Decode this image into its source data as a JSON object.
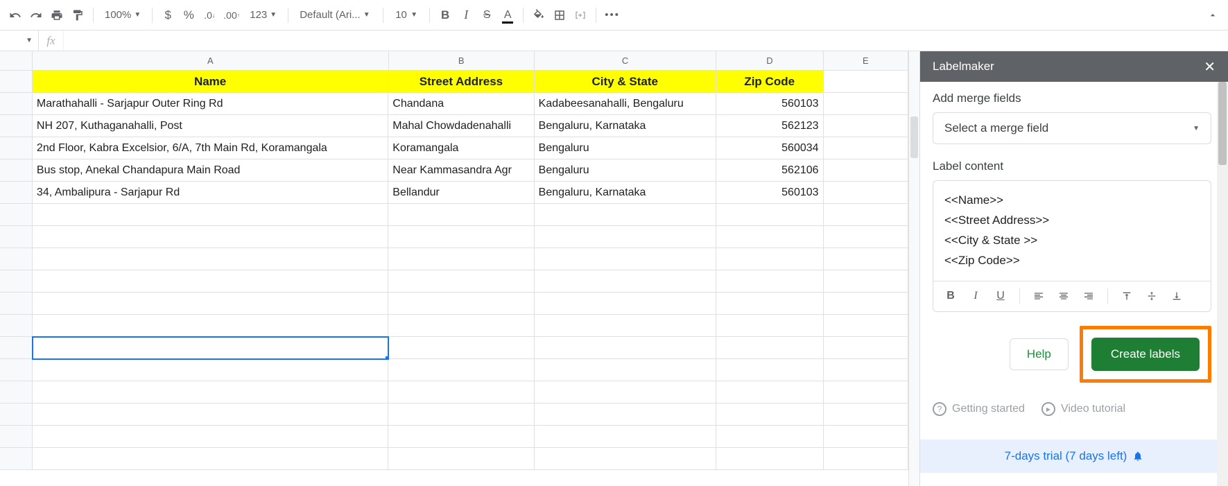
{
  "toolbar": {
    "zoom": "100%",
    "font_name": "Default (Ari...",
    "font_size": "10",
    "number_format": "123"
  },
  "sheet": {
    "columns": [
      "A",
      "B",
      "C",
      "D",
      "E"
    ],
    "headers": {
      "A": "Name",
      "B": "Street Address",
      "C": "City & State",
      "D": "Zip Code"
    },
    "rows": [
      {
        "A": "Marathahalli - Sarjapur Outer Ring Rd",
        "B": "Chandana",
        "C": "Kadabeesanahalli, Bengaluru",
        "D": "560103"
      },
      {
        "A": "NH 207, Kuthaganahalli, Post",
        "B": "Mahal Chowdadenahalli",
        "C": "Bengaluru, Karnataka",
        "D": "562123"
      },
      {
        "A": "2nd Floor, Kabra Excelsior, 6/A, 7th Main Rd, Koramangala ",
        "B": "Koramangala",
        "C": "Bengaluru",
        "D": "560034"
      },
      {
        "A": "Bus stop, Anekal Chandapura Main Road",
        "B": "Near Kammasandra Agr",
        "C": "Bengaluru",
        "D": "562106"
      },
      {
        "A": "34, Ambalipura - Sarjapur Rd",
        "B": "Bellandur",
        "C": "Bengaluru, Karnataka",
        "D": "560103"
      }
    ]
  },
  "sidebar": {
    "title": "Labelmaker",
    "merge_fields_label": "Add merge fields",
    "merge_select_placeholder": "Select a merge field",
    "label_content_label": "Label content",
    "label_content_lines": [
      "<<Name>>",
      "<<Street Address>>",
      "<<City & State >>",
      "<<Zip Code>>"
    ],
    "help_label": "Help",
    "create_label": "Create labels",
    "getting_started": "Getting started",
    "video_tutorial": "Video tutorial",
    "trial_text": "7-days trial (7 days left)"
  }
}
